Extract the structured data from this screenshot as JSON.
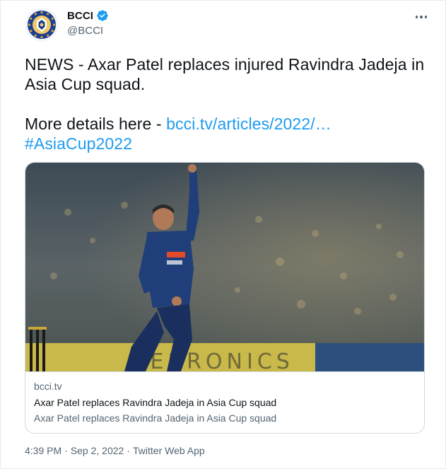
{
  "author": {
    "display_name": "BCCI",
    "handle": "@BCCI",
    "verified": true,
    "avatar_icon": "bcci-logo"
  },
  "tweet": {
    "line1": "NEWS - Axar Patel replaces injured Ravindra Jadeja in Asia Cup squad.",
    "details_prefix": "More details here - ",
    "link_text": "bcci.tv/articles/2022/…",
    "hashtag": "#AsiaCup2022"
  },
  "card": {
    "image_alt": "Cricketer bowling in stadium",
    "domain": "bcci.tv",
    "title": "Axar Patel replaces Ravindra Jadeja in Asia Cup squad",
    "description": "Axar Patel replaces Ravindra Jadeja in Asia Cup squad"
  },
  "meta": {
    "time": "4:39 PM",
    "separator": "·",
    "date": "Sep 2, 2022",
    "source": "Twitter Web App"
  },
  "colors": {
    "link": "#1d9bf0",
    "secondary_text": "#536471",
    "border": "#cfd9de",
    "verified_badge": "#1d9bf0"
  }
}
